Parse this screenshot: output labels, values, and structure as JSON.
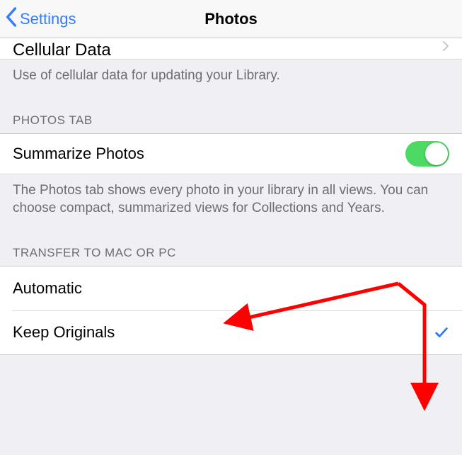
{
  "nav": {
    "back_label": "Settings",
    "title": "Photos"
  },
  "cellular": {
    "row_label": "Cellular Data",
    "footer": "Use of cellular data for updating your Library."
  },
  "photos_tab": {
    "header": "PHOTOS TAB",
    "summarize_label": "Summarize Photos",
    "summarize_on": true,
    "footer": "The Photos tab shows every photo in your library in all views. You can choose compact, summarized views for Collections and Years."
  },
  "transfer": {
    "header": "TRANSFER TO MAC OR PC",
    "options": [
      {
        "label": "Automatic",
        "selected": false
      },
      {
        "label": "Keep Originals",
        "selected": true
      }
    ]
  }
}
